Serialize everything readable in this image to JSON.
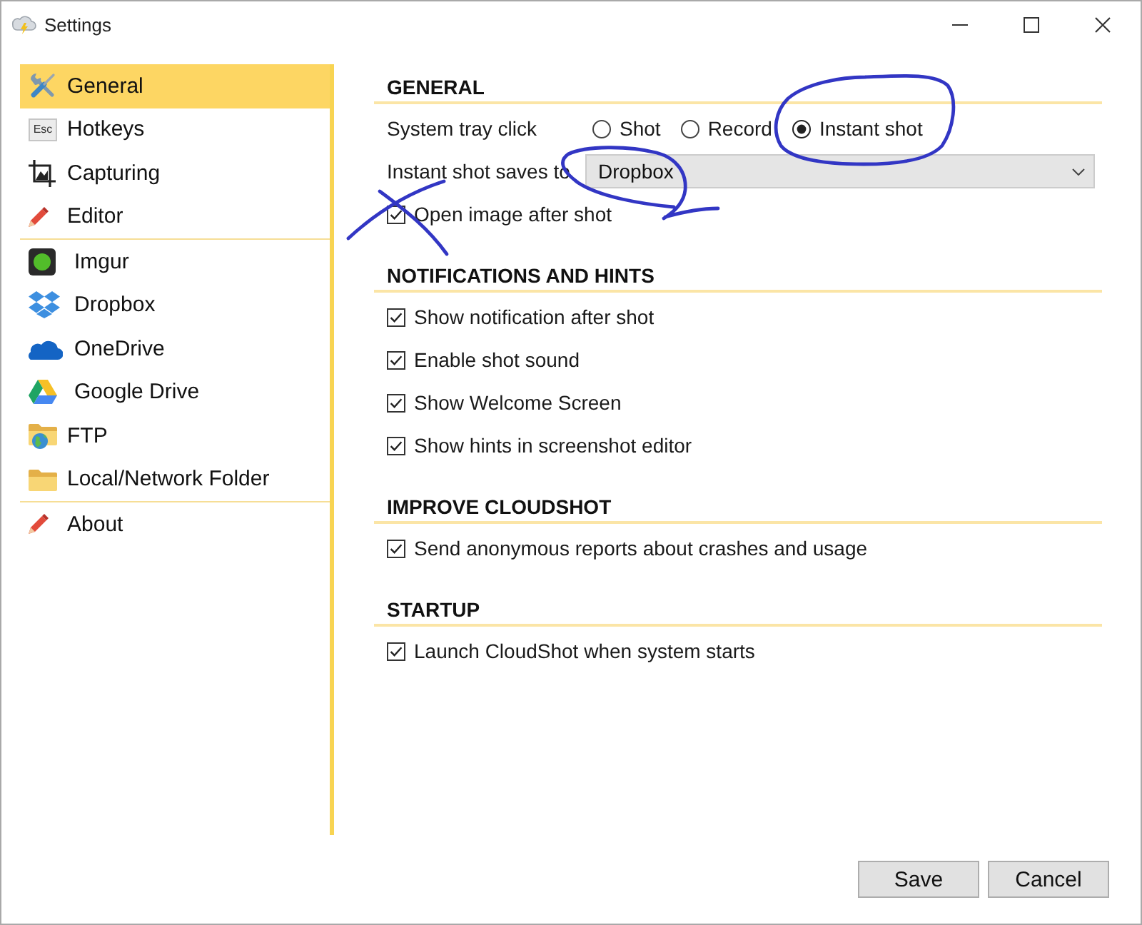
{
  "window": {
    "title": "Settings"
  },
  "sidebar": {
    "groups": [
      {
        "items": [
          {
            "label": "General",
            "selected": true
          },
          {
            "label": "Hotkeys",
            "selected": false,
            "key_label": "Esc"
          },
          {
            "label": "Capturing",
            "selected": false
          },
          {
            "label": "Editor",
            "selected": false
          }
        ]
      },
      {
        "items": [
          {
            "label": "Imgur",
            "selected": false
          },
          {
            "label": "Dropbox",
            "selected": false
          },
          {
            "label": "OneDrive",
            "selected": false
          },
          {
            "label": "Google Drive",
            "selected": false
          },
          {
            "label": "FTP",
            "selected": false
          },
          {
            "label": "Local/Network Folder",
            "selected": false
          }
        ]
      },
      {
        "items": [
          {
            "label": "About",
            "selected": false
          }
        ]
      }
    ]
  },
  "sections": [
    {
      "title": "GENERAL",
      "rows": [
        {
          "kind": "radio",
          "label": "System tray click",
          "options": [
            {
              "label": "Shot",
              "selected": false
            },
            {
              "label": "Record",
              "selected": false
            },
            {
              "label": "Instant shot",
              "selected": true
            }
          ]
        },
        {
          "kind": "dropdown",
          "label": "Instant shot saves to",
          "value": "Dropbox"
        },
        {
          "kind": "checkbox",
          "label": "Open image after shot",
          "checked": true
        }
      ]
    },
    {
      "title": "NOTIFICATIONS AND HINTS",
      "rows": [
        {
          "kind": "checkbox",
          "label": "Show notification after shot",
          "checked": true
        },
        {
          "kind": "checkbox",
          "label": "Enable shot sound",
          "checked": true
        },
        {
          "kind": "checkbox",
          "label": "Show Welcome Screen",
          "checked": true
        },
        {
          "kind": "checkbox",
          "label": "Show hints in screenshot editor",
          "checked": true
        }
      ]
    },
    {
      "title": "IMPROVE CLOUDSHOT",
      "rows": [
        {
          "kind": "checkbox",
          "label": "Send anonymous reports about crashes and usage",
          "checked": true
        }
      ]
    },
    {
      "title": "STARTUP",
      "rows": [
        {
          "kind": "checkbox",
          "label": "Launch CloudShot when system starts",
          "checked": true
        }
      ]
    }
  ],
  "buttons": [
    "Save",
    "Cancel"
  ]
}
